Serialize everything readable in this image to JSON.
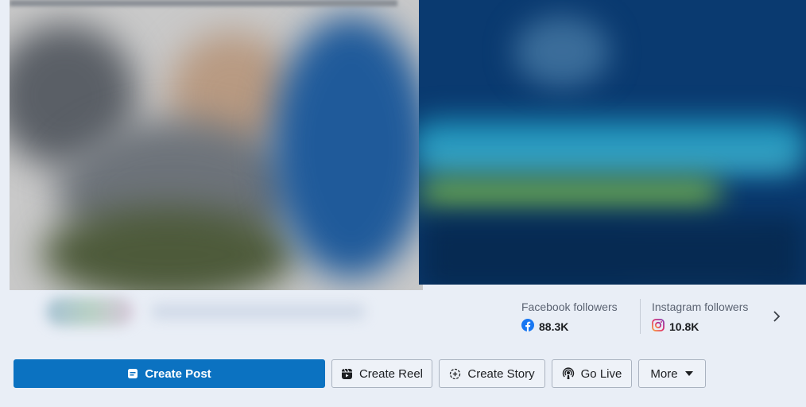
{
  "stats": {
    "facebook": {
      "label": "Facebook followers",
      "value": "88.3K",
      "icon": "facebook-icon",
      "color": "#1877f2"
    },
    "instagram": {
      "label": "Instagram followers",
      "value": "10.8K",
      "icon": "instagram-icon"
    }
  },
  "actions": {
    "create_post": "Create Post",
    "create_reel": "Create Reel",
    "create_story": "Create Story",
    "go_live": "Go Live",
    "more": "More"
  },
  "colors": {
    "primary": "#0b72c1",
    "page_bg": "#e9eef6",
    "banner": "#0a3a70"
  }
}
